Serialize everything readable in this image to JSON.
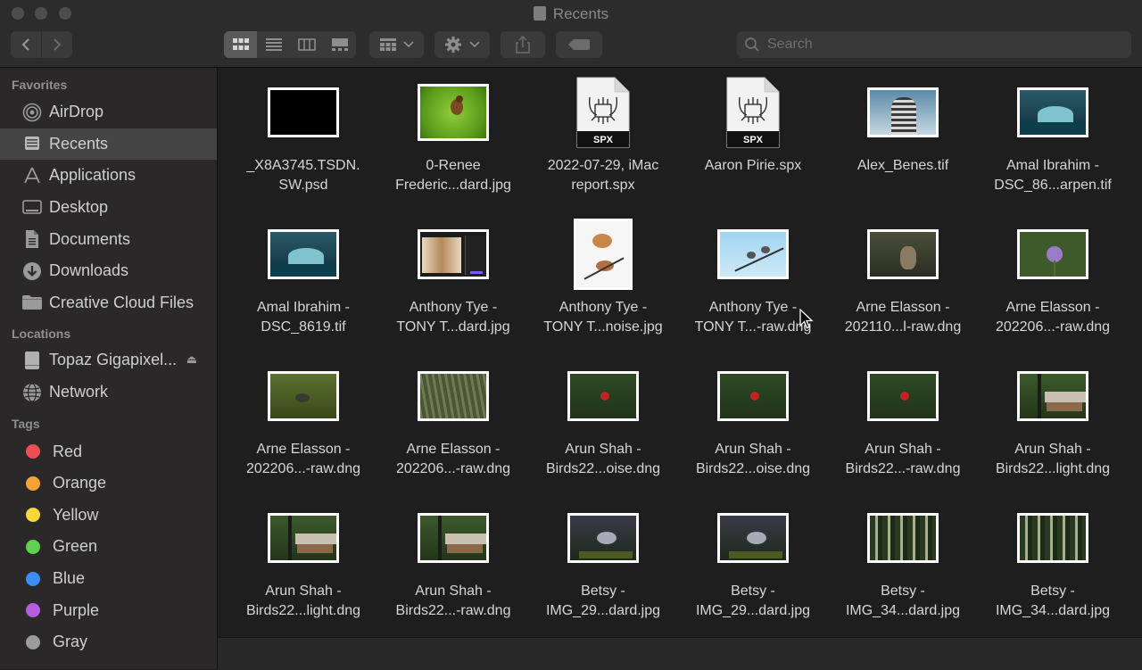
{
  "window": {
    "title": "Recents"
  },
  "toolbar": {
    "search_placeholder": "Search"
  },
  "sidebar": {
    "favorites_label": "Favorites",
    "favorites": [
      {
        "label": "AirDrop",
        "icon": "airdrop-icon"
      },
      {
        "label": "Recents",
        "icon": "recents-icon",
        "selected": true
      },
      {
        "label": "Applications",
        "icon": "applications-icon"
      },
      {
        "label": "Desktop",
        "icon": "desktop-icon"
      },
      {
        "label": "Documents",
        "icon": "documents-icon"
      },
      {
        "label": "Downloads",
        "icon": "downloads-icon"
      },
      {
        "label": "Creative Cloud Files",
        "icon": "folder-icon"
      }
    ],
    "locations_label": "Locations",
    "locations": [
      {
        "label": "Topaz Gigapixel...",
        "icon": "drive-icon"
      },
      {
        "label": "Network",
        "icon": "network-icon"
      }
    ],
    "tags_label": "Tags",
    "tags": [
      {
        "label": "Red",
        "color": "#ee4f55"
      },
      {
        "label": "Orange",
        "color": "#f5a337"
      },
      {
        "label": "Yellow",
        "color": "#f5d736"
      },
      {
        "label": "Green",
        "color": "#5dd14f"
      },
      {
        "label": "Blue",
        "color": "#3c8df7"
      },
      {
        "label": "Purple",
        "color": "#b65ee0"
      },
      {
        "label": "Gray",
        "color": "#9b9b9b"
      }
    ]
  },
  "files": [
    {
      "line1": "_X8A3745.TSDN.",
      "line2": "SW.psd",
      "kind": "black"
    },
    {
      "line1": "0-Renee",
      "line2": "Frederic...dard.jpg",
      "kind": "bird-green"
    },
    {
      "line1": "2022-07-29, iMac",
      "line2": "report.spx",
      "kind": "spx",
      "doc_label": "SPX"
    },
    {
      "line1": "Aaron Pirie.spx",
      "line2": "",
      "kind": "spx",
      "doc_label": "SPX"
    },
    {
      "line1": "Alex_Benes.tif",
      "line2": "",
      "kind": "building"
    },
    {
      "line1": "Amal Ibrahim -",
      "line2": "DSC_86...arpen.tif",
      "kind": "wave"
    },
    {
      "line1": "Amal Ibrahim -",
      "line2": "DSC_8619.tif",
      "kind": "wave"
    },
    {
      "line1": "Anthony Tye -",
      "line2": "TONY T...dard.jpg",
      "kind": "screen"
    },
    {
      "line1": "Anthony Tye -",
      "line2": "TONY T...noise.jpg",
      "kind": "birds-white"
    },
    {
      "line1": "Anthony Tye -",
      "line2": "TONY T...-raw.dng",
      "kind": "birds-blue"
    },
    {
      "line1": "Arne Elasson -",
      "line2": "202110...l-raw.dng",
      "kind": "owl"
    },
    {
      "line1": "Arne Elasson -",
      "line2": "202206...-raw.dng",
      "kind": "thistle"
    },
    {
      "line1": "Arne Elasson -",
      "line2": "202206...-raw.dng",
      "kind": "bird-olive"
    },
    {
      "line1": "Arne Elasson -",
      "line2": "202206...-raw.dng",
      "kind": "grass"
    },
    {
      "line1": "Arun Shah -",
      "line2": "Birds22...oise.dng",
      "kind": "cardinal"
    },
    {
      "line1": "Arun Shah -",
      "line2": "Birds22...oise.dng",
      "kind": "cardinal"
    },
    {
      "line1": "Arun Shah -",
      "line2": "Birds22...-raw.dng",
      "kind": "cardinal"
    },
    {
      "line1": "Arun Shah -",
      "line2": "Birds22...light.dng",
      "kind": "feeder"
    },
    {
      "line1": "Arun Shah -",
      "line2": "Birds22...light.dng",
      "kind": "feeder"
    },
    {
      "line1": "Arun Shah -",
      "line2": "Birds22...-raw.dng",
      "kind": "feeder"
    },
    {
      "line1": "Betsy -",
      "line2": "IMG_29...dard.jpg",
      "kind": "bird-dark"
    },
    {
      "line1": "Betsy -",
      "line2": "IMG_29...dard.jpg",
      "kind": "bird-dark"
    },
    {
      "line1": "Betsy -",
      "line2": "IMG_34...dard.jpg",
      "kind": "forest"
    },
    {
      "line1": "Betsy -",
      "line2": "IMG_34...dard.jpg",
      "kind": "forest"
    }
  ]
}
